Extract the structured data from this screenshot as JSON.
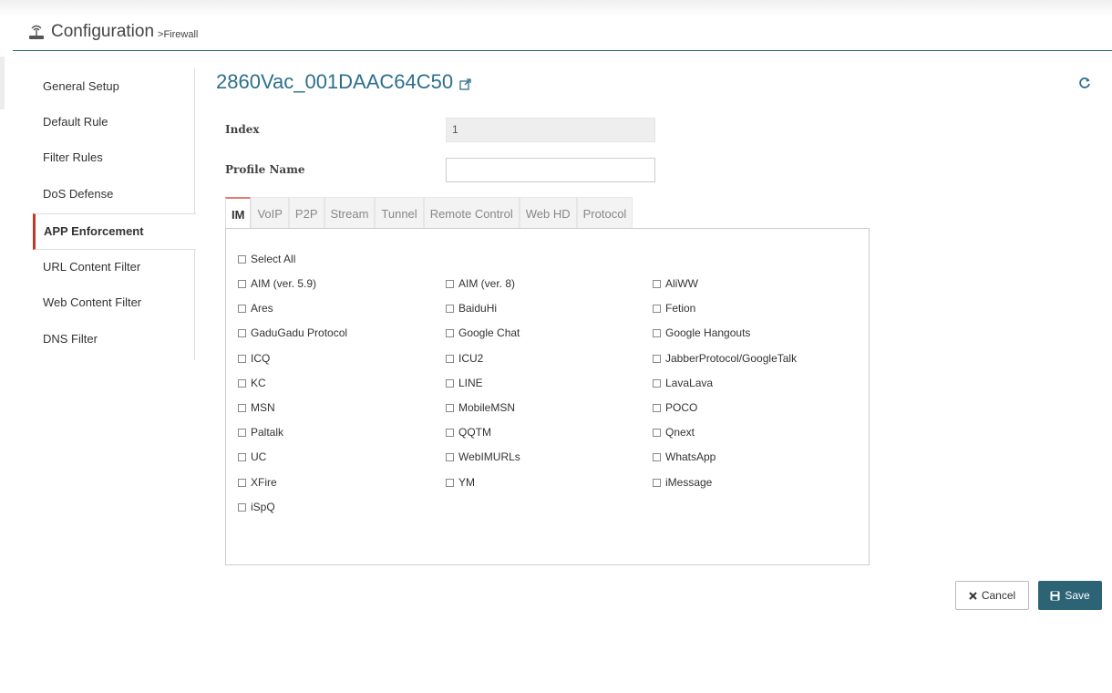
{
  "header": {
    "title": "Configuration",
    "subtitle": ">Firewall"
  },
  "device": {
    "name": "2860Vac_001DAAC64C50"
  },
  "sidebar": {
    "items": [
      {
        "label": "General Setup"
      },
      {
        "label": "Default Rule"
      },
      {
        "label": "Filter Rules"
      },
      {
        "label": "DoS Defense"
      },
      {
        "label": "APP Enforcement",
        "active": true
      },
      {
        "label": "URL Content Filter"
      },
      {
        "label": "Web Content Filter"
      },
      {
        "label": "DNS Filter"
      }
    ]
  },
  "form": {
    "index_label": "Index",
    "index_value": "1",
    "profile_name_label": "Profile Name",
    "profile_name_value": ""
  },
  "tabs": [
    "IM",
    "VoIP",
    "P2P",
    "Stream",
    "Tunnel",
    "Remote Control",
    "Web HD",
    "Protocol"
  ],
  "active_tab": "IM",
  "select_all": "Select All",
  "apps": [
    "AIM (ver. 5.9)",
    "AIM (ver. 8)",
    "AliWW",
    "Ares",
    "BaiduHi",
    "Fetion",
    "GaduGadu Protocol",
    "Google Chat",
    "Google Hangouts",
    "ICQ",
    "ICU2",
    "JabberProtocol/GoogleTalk",
    "KC",
    "LINE",
    "LavaLava",
    "MSN",
    "MobileMSN",
    "POCO",
    "Paltalk",
    "QQTM",
    "Qnext",
    "UC",
    "WebIMURLs",
    "WhatsApp",
    "XFire",
    "YM",
    "iMessage",
    "iSpQ"
  ],
  "buttons": {
    "cancel": "Cancel",
    "save": "Save"
  },
  "colors": {
    "accent": "#2c6476",
    "title": "#2c6f8c",
    "active_tab_border": "#e07b6b",
    "active_side_border": "#c0392b"
  }
}
